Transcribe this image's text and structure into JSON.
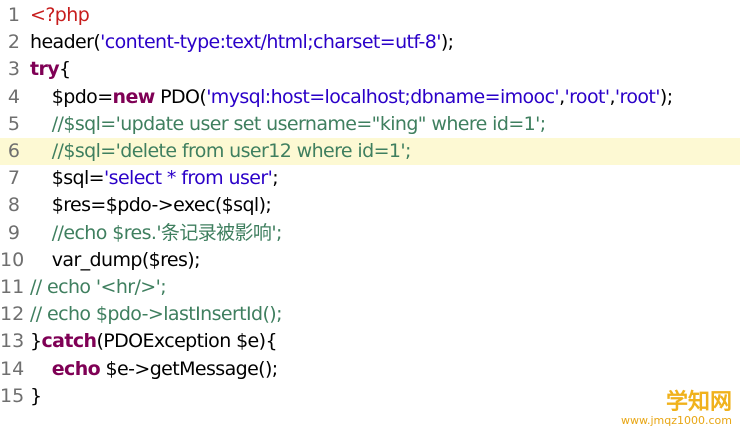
{
  "editor": {
    "line_numbers": [
      "1",
      "2",
      "3",
      "4",
      "5",
      "6",
      "7",
      "8",
      "9",
      "10",
      "11",
      "12",
      "13",
      "14",
      "15"
    ],
    "lines": [
      [
        {
          "t": "<?php",
          "c": "tag"
        }
      ],
      [
        {
          "t": "header(",
          "c": "fn"
        },
        {
          "t": "'content-type:text/html;charset=utf-8'",
          "c": "str"
        },
        {
          "t": ");",
          "c": "fn"
        }
      ],
      [
        {
          "t": "try",
          "c": "kw"
        },
        {
          "t": "{",
          "c": "fn"
        }
      ],
      [
        {
          "t": "    $pdo=",
          "c": "var"
        },
        {
          "t": "new",
          "c": "kw"
        },
        {
          "t": " PDO(",
          "c": "fn"
        },
        {
          "t": "'mysql:host=localhost;dbname=imooc'",
          "c": "str"
        },
        {
          "t": ",",
          "c": "fn"
        },
        {
          "t": "'root'",
          "c": "str"
        },
        {
          "t": ",",
          "c": "fn"
        },
        {
          "t": "'root'",
          "c": "str"
        },
        {
          "t": ");",
          "c": "fn"
        }
      ],
      [
        {
          "t": "    //$sql='update user set username=\"king\" where id=1';",
          "c": "cm"
        }
      ],
      [
        {
          "t": "    //$sql='delete from user12 where id=1';",
          "c": "cm"
        }
      ],
      [
        {
          "t": "    $sql=",
          "c": "var"
        },
        {
          "t": "'select * from user'",
          "c": "str"
        },
        {
          "t": ";",
          "c": "fn"
        }
      ],
      [
        {
          "t": "    $res=$pdo->exec($sql);",
          "c": "var"
        }
      ],
      [
        {
          "t": "    //echo $res.'条记录被影响';",
          "c": "cm"
        }
      ],
      [
        {
          "t": "    var_dump($res);",
          "c": "fn"
        }
      ],
      [
        {
          "t": "// echo '<hr/>';",
          "c": "cm"
        }
      ],
      [
        {
          "t": "// echo $pdo->lastInsertId();",
          "c": "cm"
        }
      ],
      [
        {
          "t": "}",
          "c": "fn"
        },
        {
          "t": "catch",
          "c": "kw"
        },
        {
          "t": "(PDOException $e){",
          "c": "fn"
        }
      ],
      [
        {
          "t": "    ",
          "c": "fn"
        },
        {
          "t": "echo",
          "c": "kw"
        },
        {
          "t": " $e->getMessage();",
          "c": "fn"
        }
      ],
      [
        {
          "t": "}",
          "c": "fn"
        }
      ]
    ],
    "highlighted_line": 6
  },
  "colors": {
    "tag": "#c71d1d",
    "keyword": "#7f0055",
    "string": "#2a00c8",
    "comment": "#3f7f5f",
    "line_number": "#6f6f6f",
    "highlight": "#fdf9d3"
  },
  "watermark": {
    "main": "学知网",
    "sub": "www.jmqz1000.com"
  }
}
